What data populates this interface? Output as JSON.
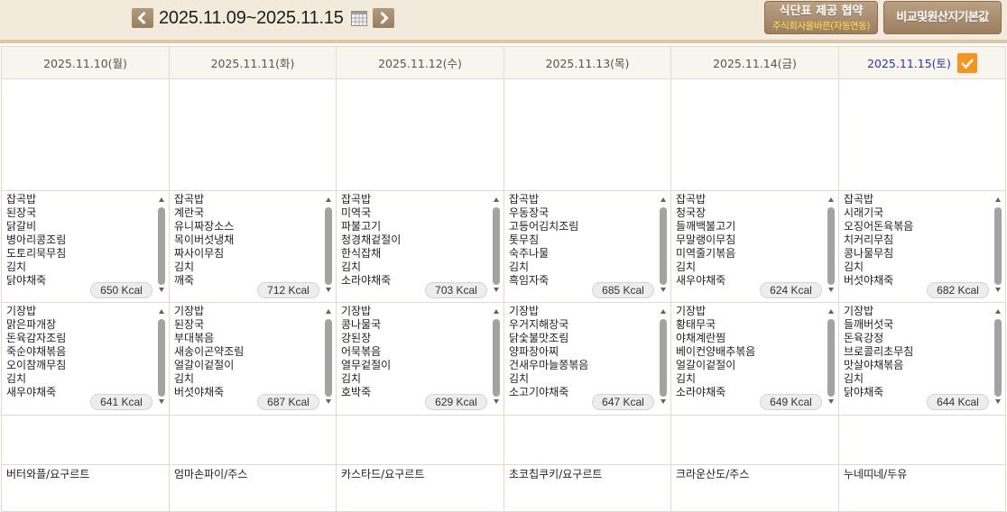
{
  "toolbar": {
    "prev_icon": "chevron-left-icon",
    "date_range": "2025.11.09~2025.11.15",
    "calendar_icon": "calendar-icon",
    "next_icon": "chevron-right-icon",
    "agreement_button": {
      "label": "식단표 제공 협약",
      "sublabel": "주식회사올바른(자동연동)"
    },
    "defaults_button": {
      "label": "비교및원산지기본값"
    }
  },
  "colors": {
    "toolbar_bg": "#f2eadb",
    "button_bg": "#a98a6c",
    "sublabel_yellow": "#ffe04a",
    "saturday_text": "#2436b3",
    "checkbox_orange": "#f7941d",
    "grid_line": "#e2dbcb",
    "header_bg": "#f8f5ee"
  },
  "days": [
    {
      "date": "2025.11.10(월)",
      "lunch": {
        "items": [
          "잡곡밥",
          "된장국",
          "닭갈비",
          "병아리콩조림",
          "도토리묵무침",
          "김치",
          "닭야채죽"
        ],
        "kcal": "650 Kcal"
      },
      "dinner": {
        "items": [
          "기장밥",
          "맑은파개장",
          "돈육감자조림",
          "죽순야채볶음",
          "오이참깨무침",
          "김치",
          "새우야채죽"
        ],
        "kcal": "641 Kcal"
      },
      "snack": "버터와플/요구르트"
    },
    {
      "date": "2025.11.11(화)",
      "lunch": {
        "items": [
          "잡곡밥",
          "계란국",
          "유니짜장소스",
          "목이버섯냉채",
          "짜사이무침",
          "김치",
          "깨죽"
        ],
        "kcal": "712 Kcal"
      },
      "dinner": {
        "items": [
          "기장밥",
          "된장국",
          "부대볶음",
          "새송이곤약조림",
          "얼갈이겉절이",
          "김치",
          "버섯야채죽"
        ],
        "kcal": "687 Kcal"
      },
      "snack": "엄마손파이/주스"
    },
    {
      "date": "2025.11.12(수)",
      "lunch": {
        "items": [
          "잡곡밥",
          "미역국",
          "파불고기",
          "청경채겉절이",
          "한식잡채",
          "김치",
          "소라야채죽"
        ],
        "kcal": "703 Kcal"
      },
      "dinner": {
        "items": [
          "기장밥",
          "콩나물국",
          "강된장",
          "어묵볶음",
          "열무겉절이",
          "김치",
          "호박죽"
        ],
        "kcal": "629 Kcal"
      },
      "snack": "카스타드/요구르트"
    },
    {
      "date": "2025.11.13(목)",
      "lunch": {
        "items": [
          "잡곡밥",
          "우동장국",
          "고등어김치조림",
          "톳무침",
          "숙주나물",
          "김치",
          "흑임자죽"
        ],
        "kcal": "685 Kcal"
      },
      "dinner": {
        "items": [
          "기장밥",
          "우거지해장국",
          "닭숯불맛조림",
          "양파장아찌",
          "건새우마늘쫑볶음",
          "김치",
          "소고기야채죽"
        ],
        "kcal": "647 Kcal"
      },
      "snack": "초코칩쿠키/요구르트"
    },
    {
      "date": "2025.11.14(금)",
      "lunch": {
        "items": [
          "잡곡밥",
          "청국장",
          "들깨백불고기",
          "무말랭이무침",
          "미역줄기볶음",
          "김치",
          "새우야채죽"
        ],
        "kcal": "624 Kcal"
      },
      "dinner": {
        "items": [
          "기장밥",
          "황태무국",
          "야채계란찜",
          "베이컨양배추볶음",
          "얼갈이겉절이",
          "김치",
          "소라야채죽"
        ],
        "kcal": "649 Kcal"
      },
      "snack": "크라운산도/주스"
    },
    {
      "date": "2025.11.15(토)",
      "checked": true,
      "lunch": {
        "items": [
          "잡곡밥",
          "시래기국",
          "오징어돈육볶음",
          "치커리무침",
          "콩나물무침",
          "김치",
          "버섯야채죽"
        ],
        "kcal": "682 Kcal"
      },
      "dinner": {
        "items": [
          "기장밥",
          "들깨버섯국",
          "돈육강정",
          "브로콜리초무침",
          "맛살야채볶음",
          "김치",
          "닭야채죽"
        ],
        "kcal": "644 Kcal"
      },
      "snack": "누네띠네/두유"
    }
  ]
}
